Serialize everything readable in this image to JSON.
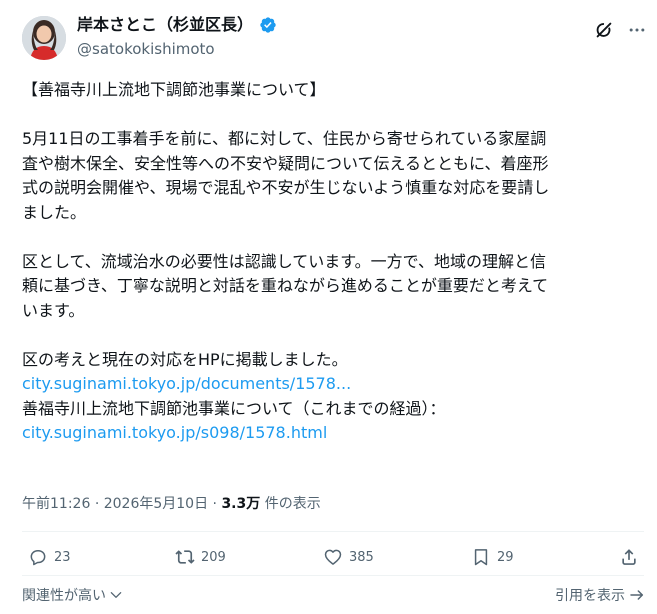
{
  "author": {
    "name": "岸本さとこ（杉並区長）",
    "handle": "@satokokishimoto",
    "verified": true
  },
  "tweet": {
    "title": "【善福寺川上流地下調節池事業について】",
    "para1": [
      "5月11日の工事着手を前に、都に対して、住民から寄せられている家屋調",
      "査や樹木保全、安全性等への不安や疑問について伝えるとともに、着座形",
      "式の説明会開催や、現場で混乱や不安が生じないよう慎重な対応を要請し",
      "ました。"
    ],
    "para2": [
      "区として、流域治水の必要性は認識しています。一方で、地域の理解と信",
      "頼に基づき、丁寧な説明と対話を重ねながら進めることが重要だと考えて",
      "います。"
    ],
    "para3": "区の考えと現在の対応をHPに掲載しました。",
    "link1": "city.suginami.tokyo.jp/documents/1578...",
    "link1_caption": "善福寺川上流地下調節池事業について（これまでの経過）：",
    "link2": "city.suginami.tokyo.jp/s098/1578.html"
  },
  "meta": {
    "time": "午前11:26",
    "separator": "·",
    "date": "2026年5月10日",
    "views_count": "3.3万",
    "views_label": "件の表示"
  },
  "actions": {
    "reply_count": "23",
    "repost_count": "209",
    "like_count": "385",
    "bookmark_count": "29"
  },
  "footer": {
    "sort_label": "関連性が高い",
    "quotes_label": "引用を表示"
  },
  "colors": {
    "link": "#1d9bf0",
    "text": "#0f1419",
    "secondary": "#536471",
    "verified": "#1d9bf0"
  }
}
